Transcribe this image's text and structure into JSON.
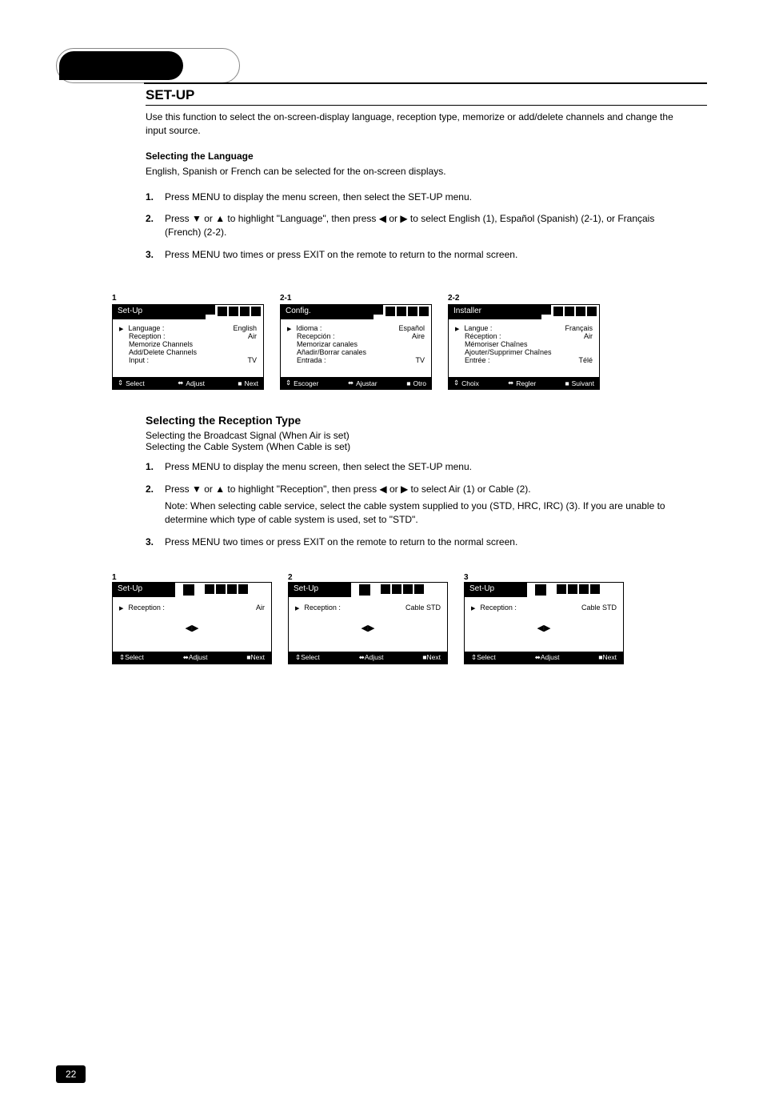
{
  "pageNumber": "22",
  "header0": "",
  "section1": {
    "title": "SET-UP",
    "intro": "Use this function to select the on-screen-display language, reception type, memorize or add/delete channels and change the input source.",
    "languageHeading": "Selecting the Language",
    "languageText": "English, Spanish or French can be selected for the on-screen displays.",
    "steps": {
      "s1": {
        "num": "1.",
        "text": "Press MENU to display the menu screen, then select the SET-UP menu."
      },
      "s2": {
        "num": "2.",
        "text": "Press ▼ or ▲ to highlight \"Language\", then press ◀ or ▶ to select English (1), Español (Spanish) (2-1), or Français (French) (2-2)."
      },
      "s3": {
        "num": "3.",
        "text": "Press MENU two times or press EXIT on the remote to return to the normal screen."
      }
    }
  },
  "menus": {
    "m1": {
      "label": "1",
      "title": "Set-Up",
      "rows": [
        {
          "lbl": "Language :",
          "val": "English",
          "marked": true
        },
        {
          "lbl": "Reception :",
          "val": "Air"
        },
        {
          "lbl": "Memorize Channels",
          "val": ""
        },
        {
          "lbl": "Add/Delete Channels",
          "val": ""
        },
        {
          "lbl": "Input :",
          "val": "TV"
        }
      ],
      "foot": [
        "Select",
        "Adjust",
        "Next"
      ]
    },
    "m2": {
      "label": "2-1",
      "title": "Config.",
      "rows": [
        {
          "lbl": "Idioma :",
          "val": "Español",
          "marked": true
        },
        {
          "lbl": "Recepción :",
          "val": "Aire"
        },
        {
          "lbl": "Memorizar canales",
          "val": ""
        },
        {
          "lbl": "Añadir/Borrar canales",
          "val": ""
        },
        {
          "lbl": "Entrada :",
          "val": "TV"
        }
      ],
      "foot": [
        "Escoger",
        "Ajustar",
        "Otro"
      ]
    },
    "m3": {
      "label": "2-2",
      "title": "Installer",
      "rows": [
        {
          "lbl": "Langue :",
          "val": "Français",
          "marked": true
        },
        {
          "lbl": "Réception :",
          "val": "Air"
        },
        {
          "lbl": "Mémoriser Chaînes",
          "val": ""
        },
        {
          "lbl": "Ajouter/Supprimer Chaînes",
          "val": ""
        },
        {
          "lbl": "Entrée :",
          "val": "Télé"
        }
      ],
      "foot": [
        "Choix",
        "Regler",
        "Suivant"
      ]
    }
  },
  "section2": {
    "heading": "Selecting the Reception Type",
    "leftRow1": "Selecting the Broadcast Signal (When Air is set)",
    "leftRow2": "Selecting the Cable System (When Cable is set)",
    "steps": {
      "s1": {
        "num": "1.",
        "text": "Press MENU to display the menu screen, then select the SET-UP menu."
      },
      "s2a": {
        "num": "2.",
        "text": "Press ▼ or ▲ to highlight \"Reception\", then press ◀ or ▶ to select Air (1) or Cable (2)."
      },
      "s2note": "Note: When selecting cable service, select the cable system supplied to you (STD, HRC, IRC) (3). If you are unable to determine which type of cable system is used, set to \"STD\".",
      "s3": {
        "num": "3.",
        "text": "Press MENU two times or press EXIT on the remote to return to the normal screen."
      }
    }
  },
  "menusB": {
    "b1": {
      "label": "1",
      "title": "Set-Up",
      "line": {
        "lbl": "Reception :",
        "val": "Air"
      },
      "foot": [
        "Select",
        "Adjust",
        "Next"
      ]
    },
    "b2": {
      "label": "2",
      "title": "Set-Up",
      "line": {
        "lbl": "Reception :",
        "val": "Cable STD"
      },
      "foot": [
        "Select",
        "Adjust",
        "Next"
      ]
    },
    "b3": {
      "label": "3",
      "title": "Set-Up",
      "line": {
        "lbl": "Reception :",
        "val": "Cable STD"
      },
      "foot": [
        "Select",
        "Adjust",
        "Next"
      ]
    }
  },
  "glyph": {
    "updown": "⇕",
    "leftright": "⬌",
    "square": "■",
    "arrows": "◀▶"
  }
}
